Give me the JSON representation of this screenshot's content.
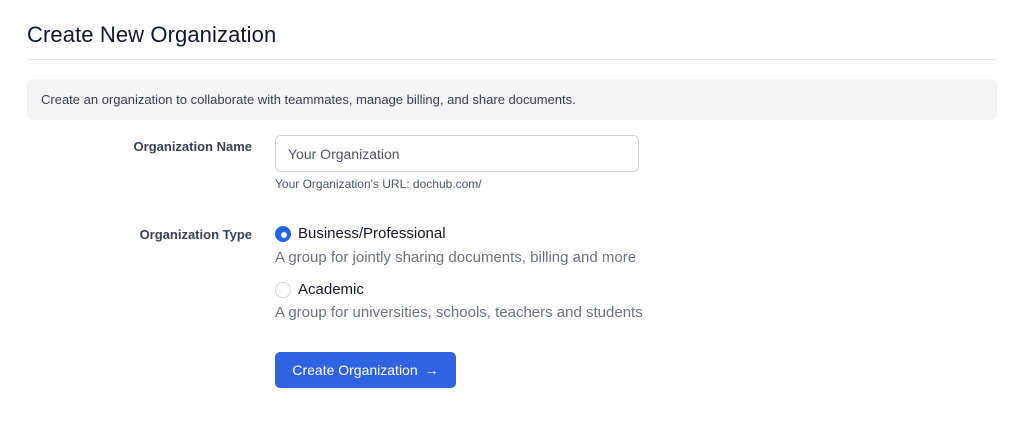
{
  "page": {
    "title": "Create New Organization",
    "intro": "Create an organization to collaborate with teammates, manage billing, and share documents."
  },
  "form": {
    "org_name": {
      "label": "Organization Name",
      "placeholder": "Your Organization",
      "value": "",
      "url_hint": "Your Organization's URL: dochub.com/"
    },
    "org_type": {
      "label": "Organization Type",
      "selected": "business",
      "options": [
        {
          "id": "business",
          "label": "Business/Professional",
          "description": "A group for jointly sharing documents, billing and more",
          "checked": true
        },
        {
          "id": "academic",
          "label": "Academic",
          "description": "A group for universities, schools, teachers and students",
          "checked": false
        }
      ]
    },
    "submit": {
      "label": "Create Organization",
      "icon": "arrow-right-icon",
      "icon_glyph": "→"
    }
  },
  "colors": {
    "accent": "#2f63e0",
    "banner_bg": "#f3f4f6",
    "muted_text": "#6b7280"
  }
}
